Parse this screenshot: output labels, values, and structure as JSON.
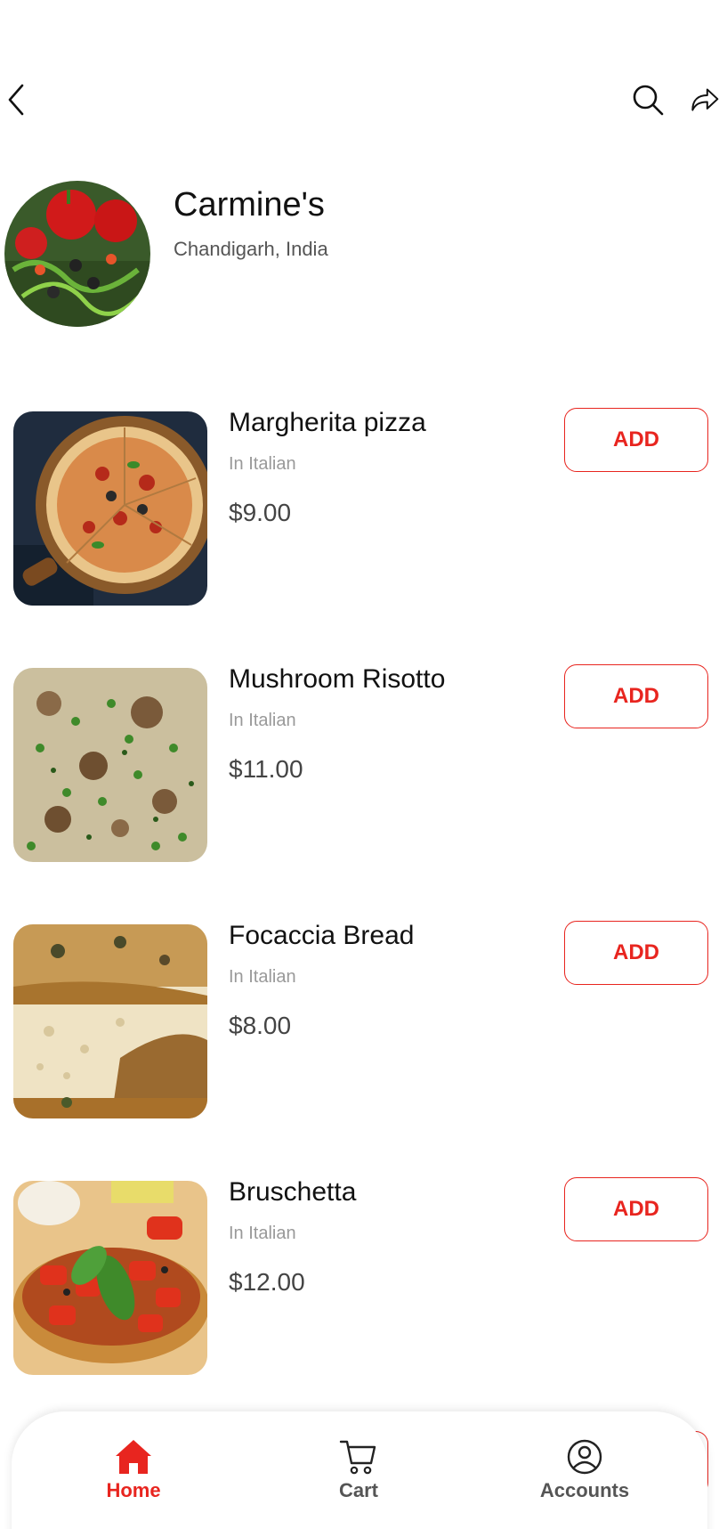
{
  "header": {
    "name": "Carmine's",
    "location": "Chandigarh, India"
  },
  "topbar": {
    "back_icon": "chevron-left-icon",
    "search_icon": "search-icon",
    "share_icon": "share-icon"
  },
  "menu": {
    "items": [
      {
        "name": "Margherita pizza",
        "category": "In Italian",
        "price": "$9.00",
        "add_label": "ADD"
      },
      {
        "name": "Mushroom Risotto",
        "category": "In Italian",
        "price": "$11.00",
        "add_label": "ADD"
      },
      {
        "name": "Focaccia Bread",
        "category": "In Italian",
        "price": "$8.00",
        "add_label": "ADD"
      },
      {
        "name": "Bruschetta",
        "category": "In Italian",
        "price": "$12.00",
        "add_label": "ADD"
      }
    ]
  },
  "nav": {
    "home": "Home",
    "cart": "Cart",
    "accounts": "Accounts",
    "active": "home"
  },
  "colors": {
    "accent": "#e8251f",
    "text_primary": "#111111",
    "text_muted": "#999999"
  }
}
